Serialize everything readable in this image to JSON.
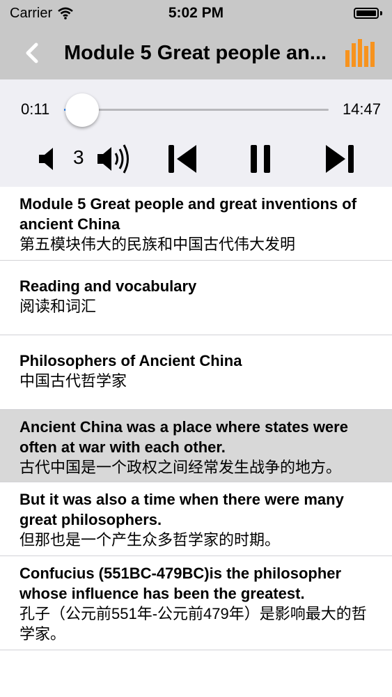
{
  "status": {
    "carrier": "Carrier",
    "time": "5:02 PM"
  },
  "nav": {
    "title": "Module 5 Great people an...",
    "accent": "#f7931e"
  },
  "player": {
    "elapsed": "0:11",
    "total": "14:47",
    "volume": "3",
    "progress": 0.012
  },
  "rows": [
    {
      "en": "Module 5 Great people and great inventions of ancient China",
      "zh": "第五模块伟大的民族和中国古代伟大发明",
      "active": false
    },
    {
      "en": "Reading and vocabulary",
      "zh": "阅读和词汇",
      "active": false
    },
    {
      "en": "Philosophers of Ancient China",
      "zh": "中国古代哲学家",
      "active": false
    },
    {
      "en": "Ancient China was a place where states were often at war with each other.",
      "zh": "古代中国是一个政权之间经常发生战争的地方。",
      "active": true
    },
    {
      "en": "But it was also a time when there were many great philosophers.",
      "zh": "但那也是一个产生众多哲学家的时期。",
      "active": false
    },
    {
      "en": "Confucius (551BC-479BC)is the philosopher whose influence has been the greatest.",
      "zh": "孔子（公元前551年-公元前479年）是影响最大的哲学家。",
      "active": false
    }
  ]
}
